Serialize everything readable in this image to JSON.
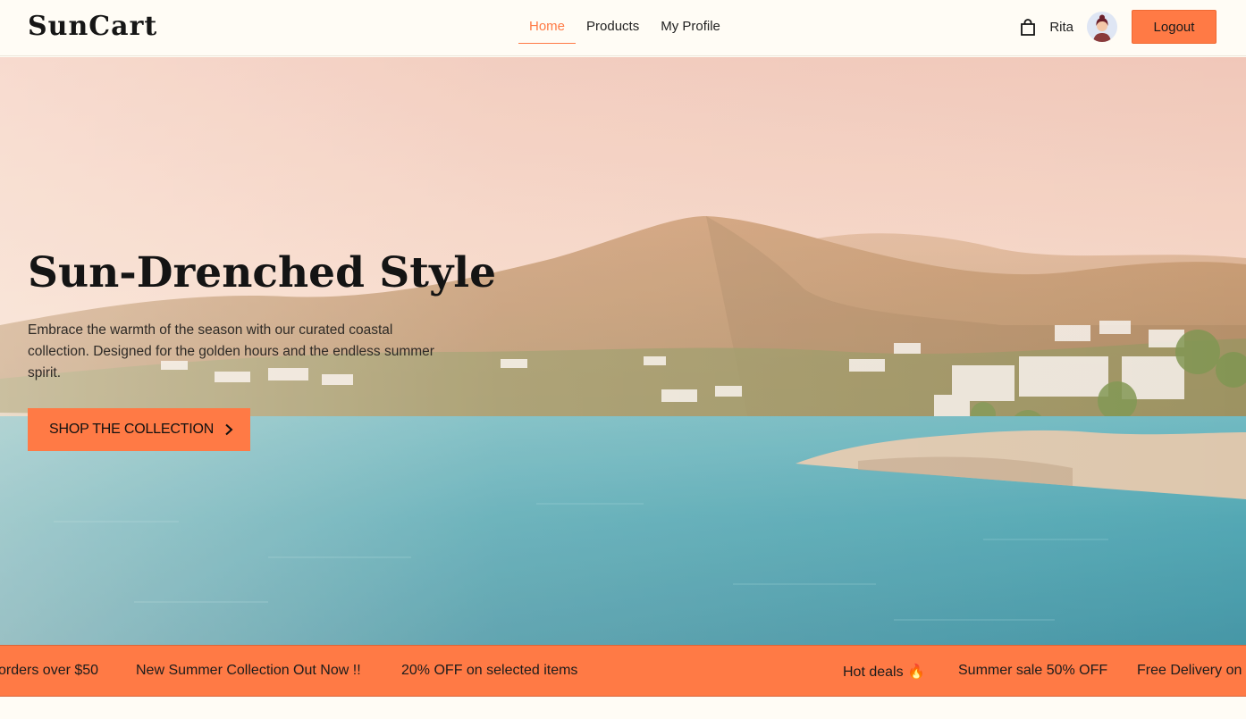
{
  "brand": "SunCart",
  "nav": {
    "items": [
      {
        "label": "Home",
        "active": true
      },
      {
        "label": "Products",
        "active": false
      },
      {
        "label": "My Profile",
        "active": false
      }
    ]
  },
  "user": {
    "name": "Rita",
    "logout_label": "Logout",
    "icons": {
      "cart": "shopping-bag-icon",
      "avatar": "user-avatar"
    }
  },
  "hero": {
    "title": "Sun-Drenched Style",
    "subtitle": "Embrace the warmth of the season with our curated coastal collection. Designed for the golden hours and the endless summer spirit.",
    "cta_label": "SHOP THE COLLECTION",
    "cta_icon": "chevron-right-icon"
  },
  "ticker": {
    "items": [
      "orders over $50",
      "New Summer Collection Out Now !!",
      "20% OFF on selected items",
      "Hot deals 🔥",
      "Summer sale 50% OFF",
      "Free Delivery on"
    ]
  },
  "colors": {
    "accent": "#ff7a45",
    "background": "#fffcf5",
    "text": "#1f1f1f"
  }
}
